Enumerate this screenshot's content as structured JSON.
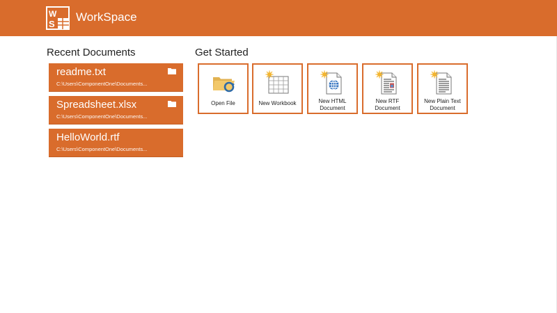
{
  "app": {
    "title": "WorkSpace",
    "accent": "#d96c2c",
    "logo_icon": "workspace-logo"
  },
  "recent": {
    "title": "Recent Documents",
    "items": [
      {
        "name": "readme.txt",
        "path": "C:\\Users\\ComponentOne\\Documents...",
        "icon": "folder-icon"
      },
      {
        "name": "Spreadsheet.xlsx",
        "path": "C:\\Users\\ComponentOne\\Documents...",
        "icon": "folder-icon"
      },
      {
        "name": "HelloWorld.rtf",
        "path": "C:\\Users\\ComponentOne\\Documents...",
        "icon": null
      }
    ]
  },
  "started": {
    "title": "Get Started",
    "tiles": [
      {
        "label": "Open File",
        "icon": "open-folder-icon"
      },
      {
        "label": "New Workbook",
        "icon": "new-workbook-icon"
      },
      {
        "label": "New HTML Document",
        "icon": "new-html-document-icon"
      },
      {
        "label": "New RTF Document",
        "icon": "new-rtf-document-icon"
      },
      {
        "label": "New Plain Text Document",
        "icon": "new-text-document-icon"
      }
    ]
  }
}
